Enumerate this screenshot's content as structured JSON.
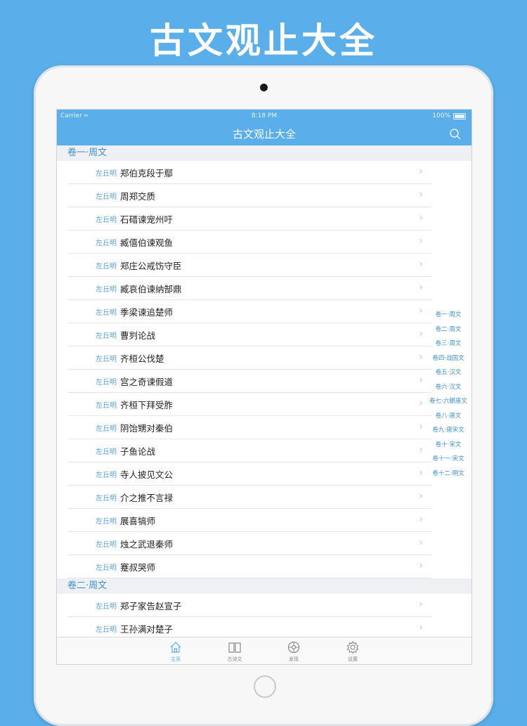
{
  "promo": {
    "title": "古文观止大全"
  },
  "statusbar": {
    "carrier": "Carrier",
    "time": "8:18 PM",
    "battery": "100%"
  },
  "navbar": {
    "title": "古文观止大全"
  },
  "sections": [
    {
      "header": "卷一·周文",
      "rows": [
        {
          "author": "左丘明",
          "title": "郑伯克段于鄢"
        },
        {
          "author": "左丘明",
          "title": "周郑交质"
        },
        {
          "author": "左丘明",
          "title": "石碏谏宠州吁"
        },
        {
          "author": "左丘明",
          "title": "臧僖伯谏观鱼"
        },
        {
          "author": "左丘明",
          "title": "郑庄公戒饬守臣"
        },
        {
          "author": "左丘明",
          "title": "臧哀伯谏纳郜鼎"
        },
        {
          "author": "左丘明",
          "title": "季梁谏追楚师"
        },
        {
          "author": "左丘明",
          "title": "曹刿论战"
        },
        {
          "author": "左丘明",
          "title": "齐桓公伐楚"
        },
        {
          "author": "左丘明",
          "title": "宫之奇谏假道"
        },
        {
          "author": "左丘明",
          "title": "齐桓下拜受胙"
        },
        {
          "author": "左丘明",
          "title": "阴饴甥对秦伯"
        },
        {
          "author": "左丘明",
          "title": "子鱼论战"
        },
        {
          "author": "左丘明",
          "title": "寺人披见文公"
        },
        {
          "author": "左丘明",
          "title": "介之推不言禄"
        },
        {
          "author": "左丘明",
          "title": "展喜犒师"
        },
        {
          "author": "左丘明",
          "title": "烛之武退秦师"
        },
        {
          "author": "左丘明",
          "title": "蹇叔哭师"
        }
      ]
    },
    {
      "header": "卷二·周文",
      "rows": [
        {
          "author": "左丘明",
          "title": "郑子家告赵宣子"
        },
        {
          "author": "左丘明",
          "title": "王孙满对楚子"
        }
      ]
    }
  ],
  "index": [
    "卷一·周文",
    "卷二·周文",
    "卷三·周文",
    "卷四·战国文",
    "卷五·汉文",
    "卷六·汉文",
    "卷七·六朝唐文",
    "卷八·唐文",
    "卷九·唐宋文",
    "卷十·宋文",
    "卷十一·宋文",
    "卷十二·明文"
  ],
  "tabs": [
    {
      "label": "主页",
      "icon": "home-icon",
      "active": true
    },
    {
      "label": "古诗文",
      "icon": "book-icon",
      "active": false
    },
    {
      "label": "发现",
      "icon": "compass-icon",
      "active": false
    },
    {
      "label": "设置",
      "icon": "gear-icon",
      "active": false
    }
  ],
  "colors": {
    "accent": "#5aaeea",
    "section_text": "#3f8fd0"
  }
}
